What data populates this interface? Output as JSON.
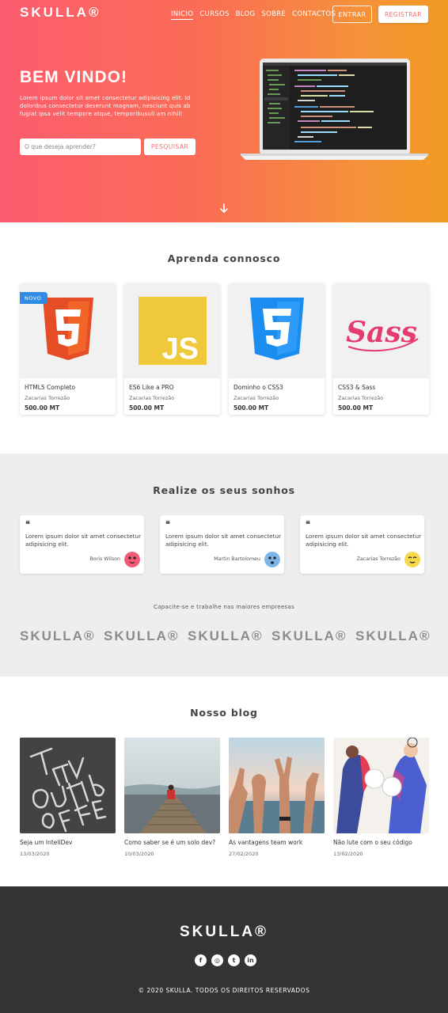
{
  "brand": {
    "logo": "SKULLA®"
  },
  "nav": {
    "items": [
      "INICIO",
      "CURSOS",
      "BLOG",
      "SOBRE",
      "CONTACTOS"
    ],
    "login": "ENTRAR",
    "register": "REGISTRAR"
  },
  "hero": {
    "title": "BEM VINDO!",
    "text": "Lorem ipsum dolor sit amet consectetur adipisicing elit. Id doloribus consectetur deserunt magnam, nesciunt quis ab fugiat ipsa velit tempore atque, temporibusull am nihil!",
    "search_placeholder": "O que deseja aprender?",
    "search_button": "PESQUISAR"
  },
  "courses": {
    "title": "Aprenda connosco",
    "badge": "NOVO",
    "items": [
      {
        "name": "HTML5 Completo",
        "author": "Zacarias Torrezão",
        "price": "500.00 MT",
        "icon": "html5-logo"
      },
      {
        "name": "ES6 Like a PRO",
        "author": "Zacarias Torrezão",
        "price": "500.00 MT",
        "icon": "js-logo"
      },
      {
        "name": "Dominho o CSS3",
        "author": "Zacarias Torrezão",
        "price": "500.00 MT",
        "icon": "css3-logo"
      },
      {
        "name": "CSS3 & Sass",
        "author": "Zacarias Torrezão",
        "price": "500.00 MT",
        "icon": "sass-logo"
      }
    ]
  },
  "dreams": {
    "title": "Realize os seus sonhos",
    "testimonials": [
      {
        "text": "Lorem ipsum dolor sit amet consectetur adipisicing elit.",
        "author": "Boris Wilson",
        "avatar_color": "#f25a77"
      },
      {
        "text": "Lorem ipsum dolor sit amet consectetur adipisicing elit.",
        "author": "Martin Bartolomeu",
        "avatar_color": "#7fb6ea"
      },
      {
        "text": "Lorem ipsum dolor sit amet consectetur adipisicing elit.",
        "author": "Zacarias Torrezão",
        "avatar_color": "#f5d94b"
      }
    ],
    "partners_title": "Capacite-se e trabalhe nas maiores empreesas",
    "partners": [
      "SKULLA®",
      "SKULLA®",
      "SKULLA®",
      "SKULLA®",
      "SKULLA®"
    ]
  },
  "blog": {
    "title": "Nosso blog",
    "posts": [
      {
        "title": "Seja um InteliDev",
        "date": "13/03/2020"
      },
      {
        "title": "Como saber se é um solo dev?",
        "date": "10/03/2020"
      },
      {
        "title": "As vantagens team work",
        "date": "27/02/2020"
      },
      {
        "title": "Não lute com o seu código",
        "date": "13/02/2020"
      }
    ]
  },
  "footer": {
    "logo": "SKULLA®",
    "social": [
      "facebook-icon",
      "instagram-icon",
      "twitter-icon",
      "linkedin-icon"
    ],
    "copyright": "© 2020 SKULLA. TODOS OS DIREITOS RESERVADOS"
  },
  "colors": {
    "gradient_start": "#fc5c6e",
    "gradient_end": "#f19b22",
    "accent": "#fb6d6d",
    "badge": "#2f8be3",
    "footer_bg": "#333333"
  }
}
